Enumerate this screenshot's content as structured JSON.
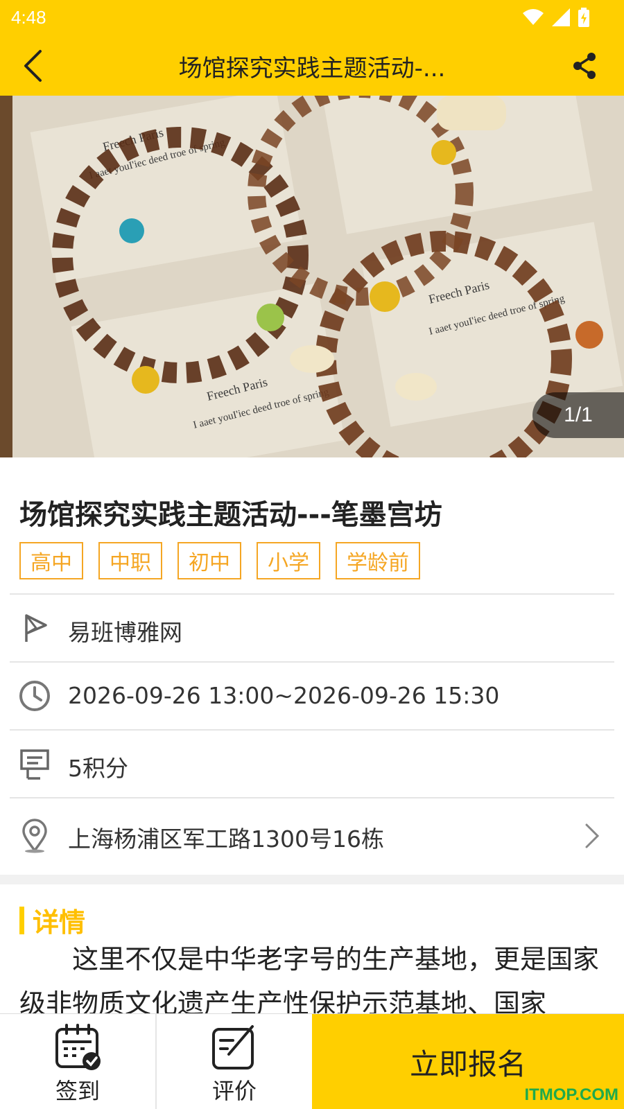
{
  "status_bar": {
    "time": "4:48"
  },
  "header": {
    "title": "场馆探究实践主题活动-..."
  },
  "banner": {
    "counter": "1/1"
  },
  "activity": {
    "title": "场馆探究实践主题活动---笔墨宫坊",
    "tags": [
      "高中",
      "中职",
      "初中",
      "小学",
      "学龄前"
    ]
  },
  "info": {
    "organizer": "易班博雅网",
    "time_range": "2026-09-26 13:00~2026-09-26 15:30",
    "points": "5积分",
    "address": "上海杨浦区军工路1300号16栋"
  },
  "detail": {
    "label": "详情",
    "text": "这里不仅是中华老字号的生产基地，更是国家级非物质文化遗产生产性保护示范基地、国家"
  },
  "bottom": {
    "checkin_label": "签到",
    "review_label": "评价",
    "signup_label": "立即报名",
    "watermark": "ITMOP.COM"
  },
  "colors": {
    "accent": "#FFCF00",
    "tag": "#F5A623",
    "watermark": "#1FAA4B"
  }
}
